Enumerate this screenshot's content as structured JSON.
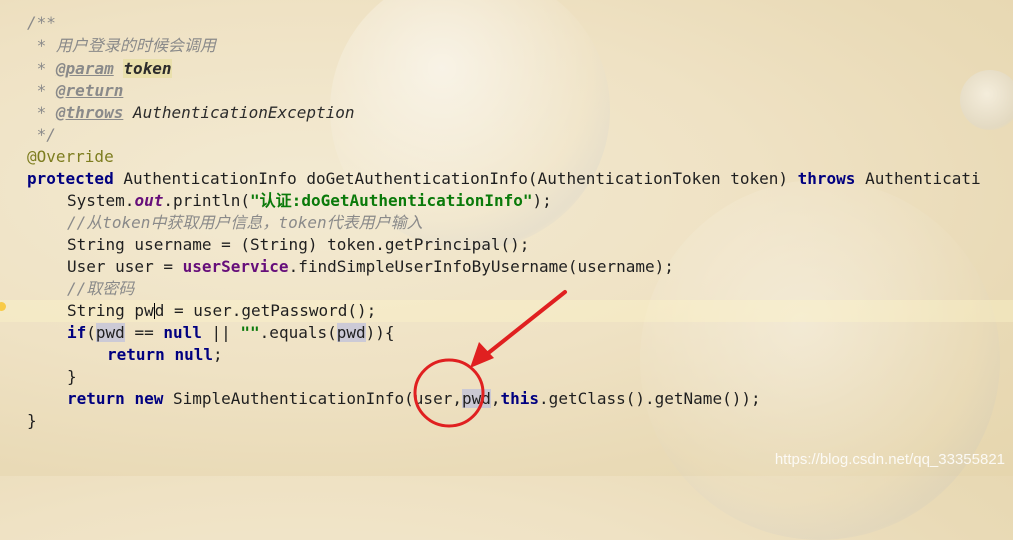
{
  "code": {
    "doc_open": "/**",
    "doc_desc": " * 用户登录的时候会调用",
    "doc_star": " * ",
    "doc_param_tag": "@param",
    "doc_param_name": "token",
    "doc_return_tag": "@return",
    "doc_throws_tag": "@throws",
    "doc_throws_type": "AuthenticationException",
    "doc_close": " */",
    "override": "@Override",
    "sig_kw": "protected",
    "sig_rest_a": "AuthenticationInfo doGetAuthenticationInfo(AuthenticationToken token) ",
    "sig_throws": "throws",
    "sig_rest_b": "Authenticati",
    "l1_a": "System.",
    "l1_out": "out",
    "l1_b": ".println(",
    "l1_str": "\"认证:doGetAuthenticationInfo\"",
    "l1_c": ");",
    "c1": "//从token中获取用户信息，token代表用户输入",
    "l2": "String username = (String) token.getPrincipal();",
    "l3_a": "User user = ",
    "l3_field": "userService",
    "l3_b": ".findSimpleUserInfoByUsername(username);",
    "c2": "//取密码",
    "l4_a": "String pw",
    "l4_b": "d = user.getPassword();",
    "l5_if": "if",
    "l5_a": "(",
    "l5_pwd1": "pwd",
    "l5_b": " == ",
    "l5_null": "null",
    "l5_c": " || ",
    "l5_str": "\"\"",
    "l5_d": ".equals(",
    "l5_pwd2": "pwd",
    "l5_e": ")){",
    "l6_ret": "return",
    "l6_null": "null",
    "l6_semi": ";",
    "l7": "}",
    "l8_ret": "return",
    "l8_new": "new",
    "l8_a": " SimpleAuthenticationInfo(user,",
    "l8_pwd": "pwd",
    "l8_b": ",",
    "l8_this": "this",
    "l8_c": ".getClass().getName());",
    "l9": "}"
  },
  "annotation": {
    "color": "#e02020"
  },
  "watermark": "https://blog.csdn.net/qq_33355821"
}
